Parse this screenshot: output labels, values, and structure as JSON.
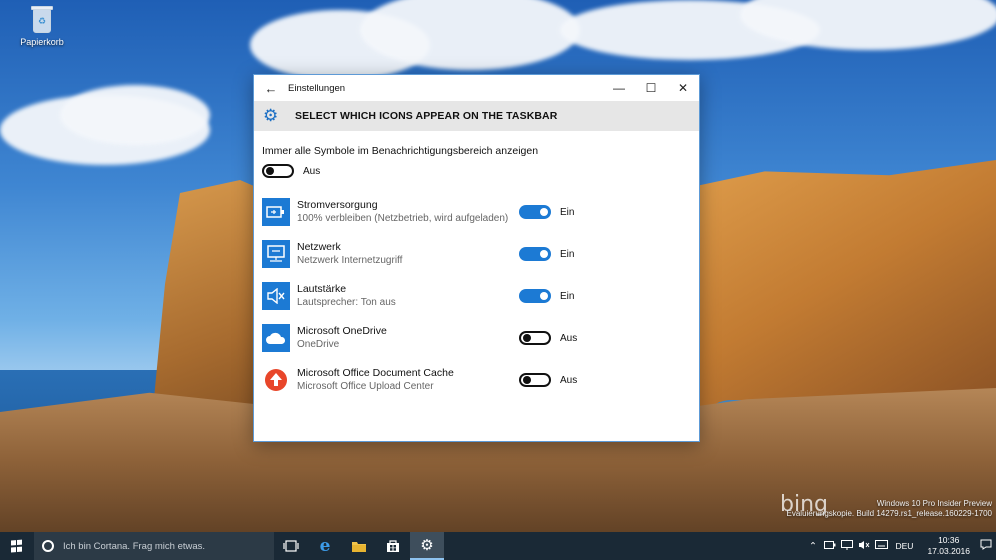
{
  "desktop": {
    "recycle_bin_label": "Papierkorb",
    "watermark_line1": "Windows 10 Pro Insider Preview",
    "watermark_line2": "Evaluierungskopie. Build 14279.rs1_release.160229-1700",
    "bing_text": "bing"
  },
  "window": {
    "title": "Einstellungen",
    "back_glyph": "←",
    "minimize_glyph": "—",
    "maximize_glyph": "☐",
    "close_glyph": "✕",
    "header_title": "SELECT WHICH ICONS APPEAR ON THE TASKBAR",
    "header_icon": "gear-icon"
  },
  "master": {
    "label": "Immer alle Symbole im Benachrichtigungsbereich anzeigen",
    "state": "Aus"
  },
  "items": [
    {
      "name": "Stromversorgung",
      "sub": "100% verbleiben (Netzbetrieb, wird aufgeladen)",
      "state": "Ein",
      "on": true,
      "icon": "power-plug-icon",
      "color": "#1c7ad4"
    },
    {
      "name": "Netzwerk",
      "sub": "Netzwerk Internetzugriff",
      "state": "Ein",
      "on": true,
      "icon": "network-icon",
      "color": "#1c7ad4"
    },
    {
      "name": "Lautstärke",
      "sub": "Lautsprecher: Ton aus",
      "state": "Ein",
      "on": true,
      "icon": "speaker-muted-icon",
      "color": "#1c7ad4"
    },
    {
      "name": "Microsoft OneDrive",
      "sub": "OneDrive",
      "state": "Aus",
      "on": false,
      "icon": "cloud-icon",
      "color": "#1c7ad4"
    },
    {
      "name": "Microsoft Office Document Cache",
      "sub": "Microsoft Office Upload Center",
      "state": "Aus",
      "on": false,
      "icon": "upload-arrow-icon",
      "color": "#e8462a"
    }
  ],
  "taskbar": {
    "cortana_placeholder": "Ich bin Cortana. Frag mich etwas.",
    "language": "DEU",
    "time": "10:36",
    "date": "17.03.2016"
  },
  "colors": {
    "accent": "#1c7ad4",
    "taskbar_bg": "#1a2936",
    "header_bg": "#e6e6e6"
  }
}
